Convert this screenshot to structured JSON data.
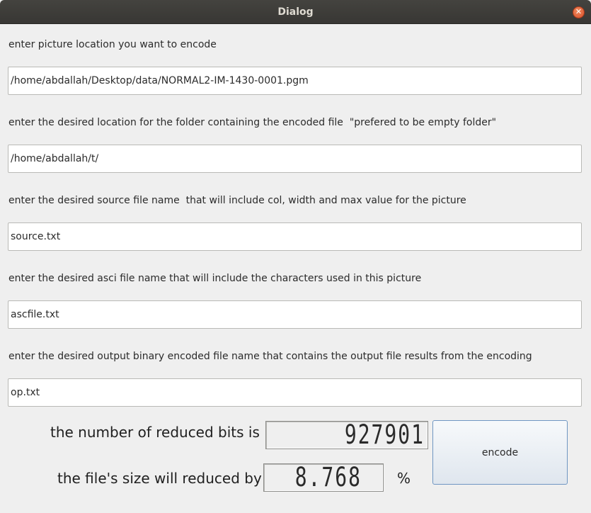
{
  "window": {
    "title": "Dialog"
  },
  "fields": [
    {
      "label": "enter picture location you want to encode",
      "value": "/home/abdallah/Desktop/data/NORMAL2-IM-1430-0001.pgm"
    },
    {
      "label": "enter the desired location for the folder containing the encoded file  \"prefered to be empty folder\"",
      "value": "/home/abdallah/t/"
    },
    {
      "label": "enter the desired source file name  that will include col, width and max value for the picture",
      "value": "source.txt"
    },
    {
      "label": "enter the desired asci file name that will include the characters used in this picture",
      "value": "ascfile.txt"
    },
    {
      "label": "enter the desired output binary encoded file name that contains the output file results from the encoding",
      "value": "op.txt"
    }
  ],
  "results": {
    "reduced_bits_label": "the number of reduced bits is",
    "reduced_bits_value": "927901",
    "size_reduction_label": "the file's size will reduced by",
    "size_reduction_value": "8.768",
    "percent_sign": "%"
  },
  "buttons": {
    "encode_label": "encode"
  }
}
